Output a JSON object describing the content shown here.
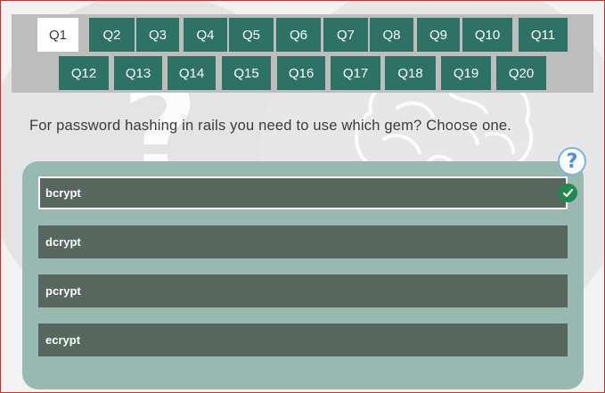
{
  "question_nav": [
    "Q1",
    "Q2",
    "Q3",
    "Q4",
    "Q5",
    "Q6",
    "Q7",
    "Q8",
    "Q9",
    "Q10",
    "Q11",
    "Q12",
    "Q13",
    "Q14",
    "Q15",
    "Q16",
    "Q17",
    "Q18",
    "Q19",
    "Q20"
  ],
  "active_question": "Q1",
  "question_text": "For password hashing in rails you need to use which gem? Choose one.",
  "help_icon": "?",
  "options": [
    "bcrypt",
    "dcrypt",
    "pcrypt",
    "ecrypt"
  ],
  "selected_option": "bcrypt",
  "colors": {
    "nav_button": "#2d7264",
    "nav_active": "#ffffff",
    "panel": "#98b8b0",
    "option": "#57665f",
    "correct_check": "#1e8a4c"
  }
}
